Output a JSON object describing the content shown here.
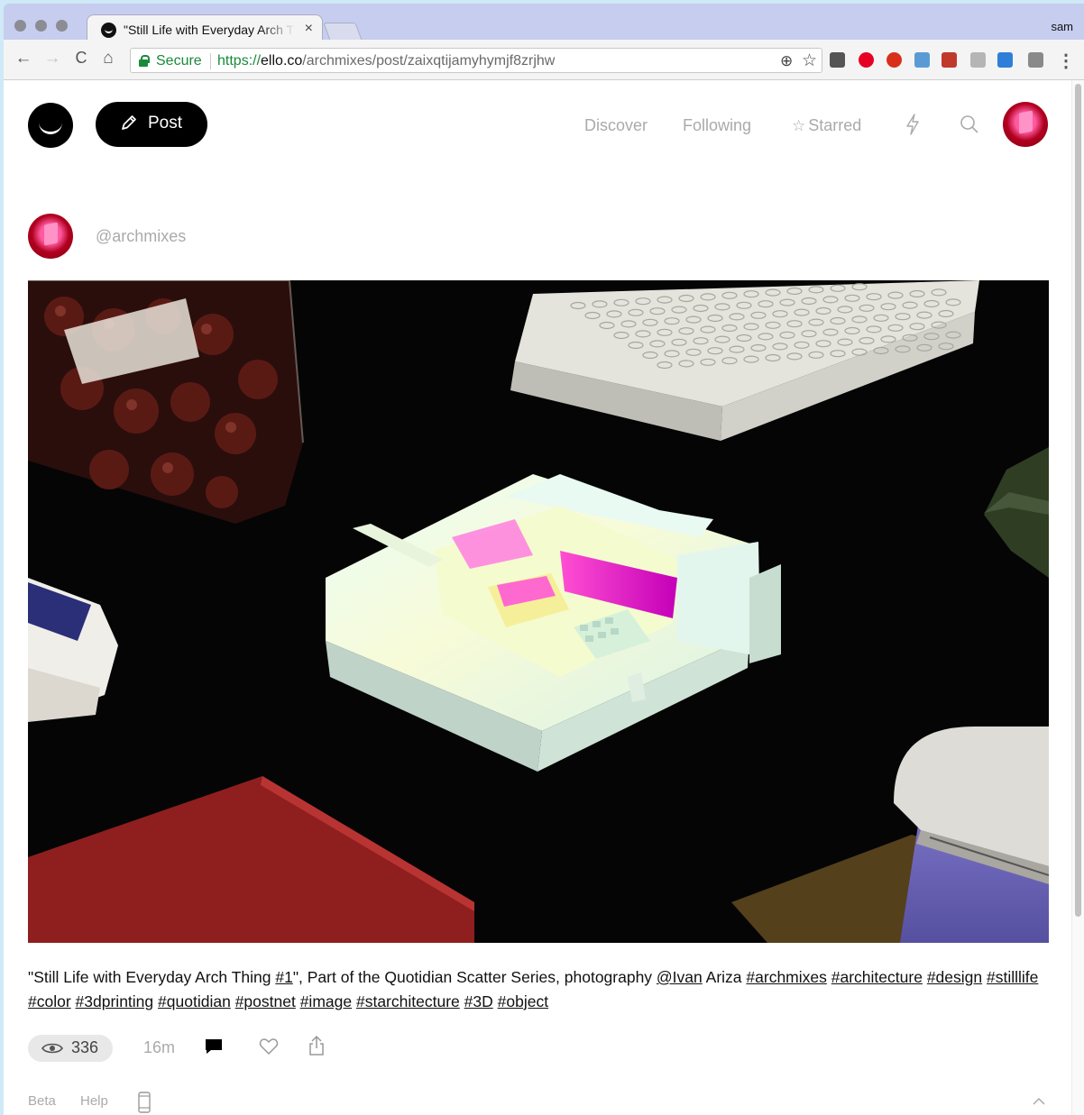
{
  "browser": {
    "tab_title": "\"Still Life with Everyday Arch Thing #1\"",
    "tab_close": "×",
    "profile": "sam",
    "secure_label": "Secure",
    "url_scheme": "https://",
    "url_host": "ello.co",
    "url_path": "/archmixes/post/zaixqtijamyhymjf8zrjhw",
    "nav": {
      "back": "←",
      "forward": "→",
      "reload": "C",
      "home": "⌂"
    },
    "omnibox_icons": {
      "zoom": "⊕",
      "bookmark": "☆"
    },
    "extensions": [
      {
        "name": "typewriter-extension-icon",
        "color": "#555555"
      },
      {
        "name": "pinterest-extension-icon",
        "color": "#e60023"
      },
      {
        "name": "ublock-extension-icon",
        "color": "#d9301b"
      },
      {
        "name": "docs-extension-icon",
        "color": "#5b9bd5"
      },
      {
        "name": "bars-extension-icon",
        "color": "#c0392b"
      },
      {
        "name": "drive-extension-icon",
        "color": "#b5b5b5"
      },
      {
        "name": "resize-extension-icon",
        "color": "#2f7fd8"
      },
      {
        "name": "camera-extension-icon",
        "color": "#8a8a8a"
      }
    ]
  },
  "header": {
    "post_button": "Post",
    "nav": {
      "discover": "Discover",
      "following": "Following",
      "starred": "Starred"
    },
    "star_glyph": "☆"
  },
  "post": {
    "author": "@archmixes",
    "caption": [
      {
        "text": "\"Still Life with Everyday Arch Thing ",
        "link": false
      },
      {
        "text": "#1",
        "link": true
      },
      {
        "text": "\", Part of the Quotidian Scatter Series, photography ",
        "link": false
      },
      {
        "text": "@Ivan",
        "link": true
      },
      {
        "text": " Ariza ",
        "link": false
      },
      {
        "text": "#archmixes",
        "link": true
      },
      {
        "text": " ",
        "link": false
      },
      {
        "text": "#architecture",
        "link": true
      },
      {
        "text": " ",
        "link": false
      },
      {
        "text": "#design",
        "link": true
      },
      {
        "text": " ",
        "link": false
      },
      {
        "text": "#stilllife",
        "link": true
      },
      {
        "text": " ",
        "link": false
      },
      {
        "text": "#color",
        "link": true
      },
      {
        "text": " ",
        "link": false
      },
      {
        "text": "#3dprinting",
        "link": true
      },
      {
        "text": " ",
        "link": false
      },
      {
        "text": "#quotidian",
        "link": true
      },
      {
        "text": " ",
        "link": false
      },
      {
        "text": "#postnet",
        "link": true
      },
      {
        "text": " ",
        "link": false
      },
      {
        "text": "#image",
        "link": true
      },
      {
        "text": " ",
        "link": false
      },
      {
        "text": "#starchitecture",
        "link": true
      },
      {
        "text": " ",
        "link": false
      },
      {
        "text": "#3D",
        "link": true
      },
      {
        "text": " ",
        "link": false
      },
      {
        "text": "#object",
        "link": true
      }
    ],
    "views": "336",
    "time_ago": "16m"
  },
  "footer": {
    "beta": "Beta",
    "help": "Help"
  },
  "colors": {
    "accent_black": "#000000",
    "muted_text": "#aaaaaa",
    "secure_green": "#1a8a3a"
  }
}
